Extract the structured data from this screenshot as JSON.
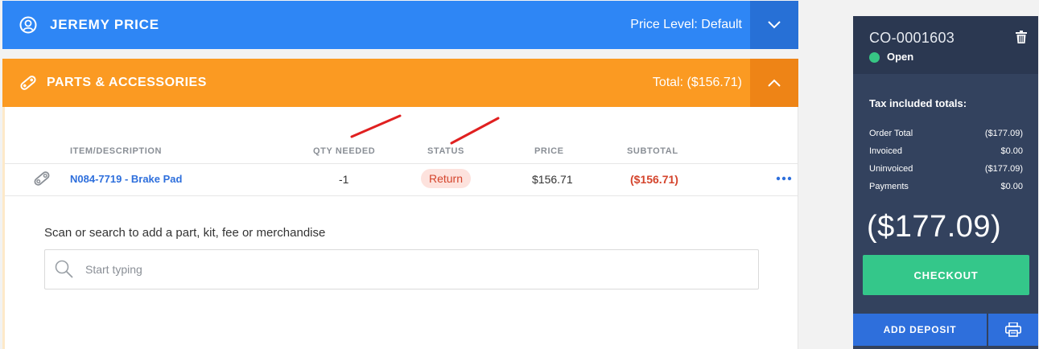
{
  "customer": {
    "name": "JEREMY PRICE",
    "price_level": "Price Level: Default",
    "icon": "user-circle-icon",
    "color": "#2e86f5"
  },
  "parts": {
    "title": "PARTS & ACCESSORIES",
    "total": "Total: ($156.71)",
    "icon": "parts-link-icon",
    "color": "#fb9a22",
    "columns": {
      "item": "ITEM/DESCRIPTION",
      "qty": "QTY NEEDED",
      "status": "STATUS",
      "price": "PRICE",
      "subtotal": "SUBTOTAL"
    },
    "rows": [
      {
        "item": "N084-7719 - Brake Pad",
        "qty": "-1",
        "status": "Return",
        "price": "$156.71",
        "subtotal": "($156.71)"
      }
    ],
    "search": {
      "label": "Scan or search to add a part, kit, fee or merchandise",
      "placeholder": "Start typing",
      "value": ""
    }
  },
  "order": {
    "id": "CO-0001603",
    "status": "Open",
    "status_color": "#37c684",
    "tax_title": "Tax included totals:",
    "totals": [
      {
        "label": "Order Total",
        "value": "($177.09)"
      },
      {
        "label": "Invoiced",
        "value": "$0.00"
      },
      {
        "label": "Uninvoiced",
        "value": "($177.09)"
      },
      {
        "label": "Payments",
        "value": "$0.00"
      }
    ],
    "balance": "($177.09)",
    "checkout_label": "CHECKOUT",
    "deposit_label": "ADD DEPOSIT"
  }
}
